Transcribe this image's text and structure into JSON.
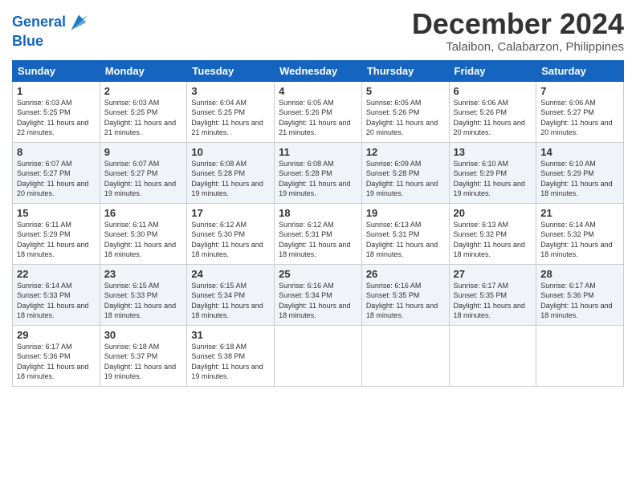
{
  "logo": {
    "line1": "General",
    "line2": "Blue"
  },
  "title": "December 2024",
  "location": "Talaibon, Calabarzon, Philippines",
  "days_of_week": [
    "Sunday",
    "Monday",
    "Tuesday",
    "Wednesday",
    "Thursday",
    "Friday",
    "Saturday"
  ],
  "weeks": [
    [
      {
        "day": "1",
        "sunrise": "6:03 AM",
        "sunset": "5:25 PM",
        "daylight": "11 hours and 22 minutes."
      },
      {
        "day": "2",
        "sunrise": "6:03 AM",
        "sunset": "5:25 PM",
        "daylight": "11 hours and 21 minutes."
      },
      {
        "day": "3",
        "sunrise": "6:04 AM",
        "sunset": "5:25 PM",
        "daylight": "11 hours and 21 minutes."
      },
      {
        "day": "4",
        "sunrise": "6:05 AM",
        "sunset": "5:26 PM",
        "daylight": "11 hours and 21 minutes."
      },
      {
        "day": "5",
        "sunrise": "6:05 AM",
        "sunset": "5:26 PM",
        "daylight": "11 hours and 20 minutes."
      },
      {
        "day": "6",
        "sunrise": "6:06 AM",
        "sunset": "5:26 PM",
        "daylight": "11 hours and 20 minutes."
      },
      {
        "day": "7",
        "sunrise": "6:06 AM",
        "sunset": "5:27 PM",
        "daylight": "11 hours and 20 minutes."
      }
    ],
    [
      {
        "day": "8",
        "sunrise": "6:07 AM",
        "sunset": "5:27 PM",
        "daylight": "11 hours and 20 minutes."
      },
      {
        "day": "9",
        "sunrise": "6:07 AM",
        "sunset": "5:27 PM",
        "daylight": "11 hours and 19 minutes."
      },
      {
        "day": "10",
        "sunrise": "6:08 AM",
        "sunset": "5:28 PM",
        "daylight": "11 hours and 19 minutes."
      },
      {
        "day": "11",
        "sunrise": "6:08 AM",
        "sunset": "5:28 PM",
        "daylight": "11 hours and 19 minutes."
      },
      {
        "day": "12",
        "sunrise": "6:09 AM",
        "sunset": "5:28 PM",
        "daylight": "11 hours and 19 minutes."
      },
      {
        "day": "13",
        "sunrise": "6:10 AM",
        "sunset": "5:29 PM",
        "daylight": "11 hours and 19 minutes."
      },
      {
        "day": "14",
        "sunrise": "6:10 AM",
        "sunset": "5:29 PM",
        "daylight": "11 hours and 18 minutes."
      }
    ],
    [
      {
        "day": "15",
        "sunrise": "6:11 AM",
        "sunset": "5:29 PM",
        "daylight": "11 hours and 18 minutes."
      },
      {
        "day": "16",
        "sunrise": "6:11 AM",
        "sunset": "5:30 PM",
        "daylight": "11 hours and 18 minutes."
      },
      {
        "day": "17",
        "sunrise": "6:12 AM",
        "sunset": "5:30 PM",
        "daylight": "11 hours and 18 minutes."
      },
      {
        "day": "18",
        "sunrise": "6:12 AM",
        "sunset": "5:31 PM",
        "daylight": "11 hours and 18 minutes."
      },
      {
        "day": "19",
        "sunrise": "6:13 AM",
        "sunset": "5:31 PM",
        "daylight": "11 hours and 18 minutes."
      },
      {
        "day": "20",
        "sunrise": "6:13 AM",
        "sunset": "5:32 PM",
        "daylight": "11 hours and 18 minutes."
      },
      {
        "day": "21",
        "sunrise": "6:14 AM",
        "sunset": "5:32 PM",
        "daylight": "11 hours and 18 minutes."
      }
    ],
    [
      {
        "day": "22",
        "sunrise": "6:14 AM",
        "sunset": "5:33 PM",
        "daylight": "11 hours and 18 minutes."
      },
      {
        "day": "23",
        "sunrise": "6:15 AM",
        "sunset": "5:33 PM",
        "daylight": "11 hours and 18 minutes."
      },
      {
        "day": "24",
        "sunrise": "6:15 AM",
        "sunset": "5:34 PM",
        "daylight": "11 hours and 18 minutes."
      },
      {
        "day": "25",
        "sunrise": "6:16 AM",
        "sunset": "5:34 PM",
        "daylight": "11 hours and 18 minutes."
      },
      {
        "day": "26",
        "sunrise": "6:16 AM",
        "sunset": "5:35 PM",
        "daylight": "11 hours and 18 minutes."
      },
      {
        "day": "27",
        "sunrise": "6:17 AM",
        "sunset": "5:35 PM",
        "daylight": "11 hours and 18 minutes."
      },
      {
        "day": "28",
        "sunrise": "6:17 AM",
        "sunset": "5:36 PM",
        "daylight": "11 hours and 18 minutes."
      }
    ],
    [
      {
        "day": "29",
        "sunrise": "6:17 AM",
        "sunset": "5:36 PM",
        "daylight": "11 hours and 18 minutes."
      },
      {
        "day": "30",
        "sunrise": "6:18 AM",
        "sunset": "5:37 PM",
        "daylight": "11 hours and 19 minutes."
      },
      {
        "day": "31",
        "sunrise": "6:18 AM",
        "sunset": "5:38 PM",
        "daylight": "11 hours and 19 minutes."
      },
      null,
      null,
      null,
      null
    ]
  ]
}
